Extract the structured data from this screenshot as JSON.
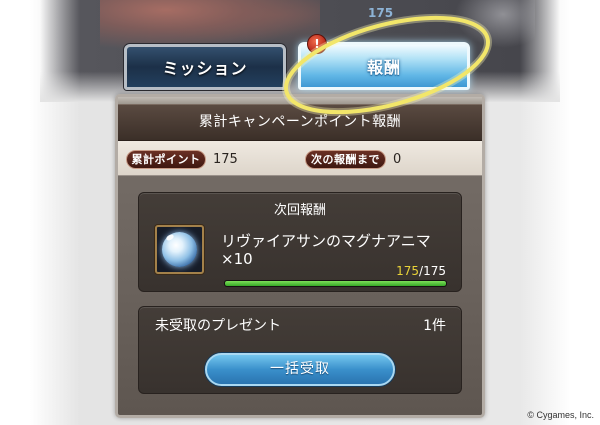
{
  "header": {
    "top_counter": "175"
  },
  "tabs": [
    {
      "label": "ミッション",
      "active": false
    },
    {
      "label": "報酬",
      "active": true,
      "badge": "!"
    }
  ],
  "panel": {
    "title": "累計キャンペーンポイント報酬",
    "total_points": {
      "label": "累計ポイント",
      "value": "175"
    },
    "until_next_reward": {
      "label": "次の報酬まで",
      "value": "0"
    }
  },
  "next_reward": {
    "title": "次回報酬",
    "item_icon": "magna-anima-orb-icon",
    "item_name": "リヴァイアサンのマグナアニマ",
    "item_quantity": "×10",
    "progress": {
      "current": "175",
      "separator": "/",
      "total": "175",
      "fraction": 1
    }
  },
  "presents": {
    "label": "未受取のプレゼント",
    "count": "1件",
    "claim_all_label": "一括受取"
  },
  "footer": {
    "copyright": "© Cygames, Inc."
  },
  "colors": {
    "active_tab": "#3e98d3",
    "inactive_tab": "#1c3048",
    "highlight_ring": "#f2e66a",
    "progress_fill": "#36a826",
    "progress_current_text": "#e8d238",
    "alert_badge": "#b3261a"
  }
}
